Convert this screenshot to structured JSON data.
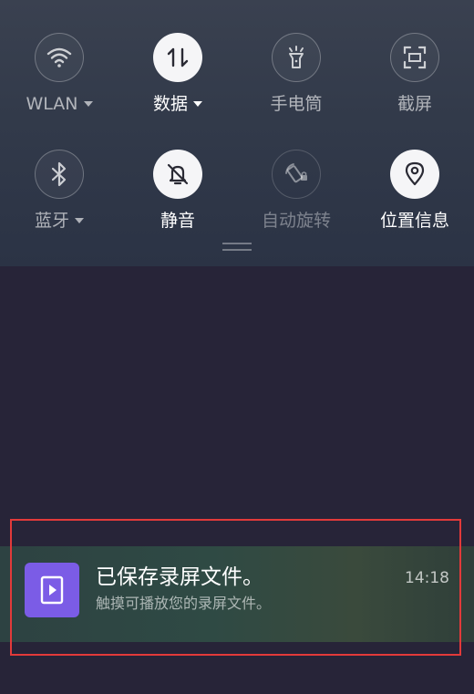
{
  "quick_settings": {
    "row1": [
      {
        "label": "WLAN",
        "state": "off",
        "dropdown": true,
        "icon": "wifi-icon"
      },
      {
        "label": "数据",
        "state": "on",
        "dropdown": true,
        "icon": "mobile-data-icon"
      },
      {
        "label": "手电筒",
        "state": "off",
        "dropdown": false,
        "icon": "flashlight-icon"
      },
      {
        "label": "截屏",
        "state": "off",
        "dropdown": false,
        "icon": "screenshot-icon"
      }
    ],
    "row2": [
      {
        "label": "蓝牙",
        "state": "off",
        "dropdown": true,
        "icon": "bluetooth-icon"
      },
      {
        "label": "静音",
        "state": "on",
        "dropdown": false,
        "icon": "bell-mute-icon"
      },
      {
        "label": "自动旋转",
        "state": "dim",
        "dropdown": false,
        "icon": "auto-rotate-icon"
      },
      {
        "label": "位置信息",
        "state": "on",
        "dropdown": false,
        "icon": "location-icon"
      }
    ]
  },
  "notification": {
    "title": "已保存录屏文件。",
    "body": "触摸可播放您的录屏文件。",
    "time": "14:18",
    "icon": "screen-record-icon",
    "icon_color": "#7b5ce6"
  },
  "colors": {
    "highlight_border": "#e23a3a",
    "active_tile": "#f5f5f7",
    "background": "#272438"
  }
}
